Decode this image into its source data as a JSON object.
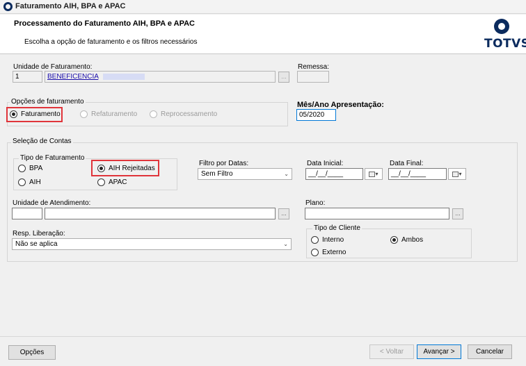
{
  "window": {
    "title": "Faturamento AIH, BPA e APAC"
  },
  "header": {
    "title": "Processamento do Faturamento AIH, BPA e APAC",
    "subtitle": "Escolha a opção de faturamento e os filtros necessários",
    "brand": "TOTVS"
  },
  "unidade_faturamento": {
    "label": "Unidade de Faturamento:",
    "code": "1",
    "name": "BENEFICENCIA"
  },
  "remessa": {
    "label": "Remessa:",
    "value": ""
  },
  "opcoes_faturamento": {
    "legend": "Opções de faturamento",
    "options": [
      {
        "label": "Faturamento",
        "selected": true,
        "enabled": true
      },
      {
        "label": "Refaturamento",
        "selected": false,
        "enabled": false
      },
      {
        "label": "Reprocessamento",
        "selected": false,
        "enabled": false
      }
    ]
  },
  "mes_ano": {
    "label": "Mês/Ano Apresentação:",
    "value": "05/2020"
  },
  "selecao_contas": {
    "legend": "Seleção de Contas",
    "tipo_faturamento": {
      "legend": "Tipo de Faturamento",
      "options": [
        {
          "label": "BPA",
          "selected": false
        },
        {
          "label": "AIH Rejeitadas",
          "selected": true
        },
        {
          "label": "AIH",
          "selected": false
        },
        {
          "label": "APAC",
          "selected": false
        }
      ]
    },
    "filtro_datas": {
      "label": "Filtro por Datas:",
      "value": "Sem Filtro"
    },
    "data_inicial": {
      "label": "Data Inicial:",
      "value": "__/__/____"
    },
    "data_final": {
      "label": "Data Final:",
      "value": "__/__/____"
    },
    "unidade_atendimento": {
      "label": "Unidade de Atendimento:",
      "code": "",
      "name": ""
    },
    "plano": {
      "label": "Plano:",
      "value": ""
    },
    "resp_liberacao": {
      "label": "Resp. Liberação:",
      "value": "Não se aplica"
    },
    "tipo_cliente": {
      "legend": "Tipo de Cliente",
      "options": [
        {
          "label": "Interno",
          "selected": false
        },
        {
          "label": "Ambos",
          "selected": true
        },
        {
          "label": "Externo",
          "selected": false
        }
      ]
    }
  },
  "footer": {
    "opcoes": "Opções",
    "voltar": "< Voltar",
    "avancar": "Avançar >",
    "cancelar": "Cancelar"
  },
  "icons": {
    "ellipsis": "...",
    "dropdown": "▾"
  },
  "colors": {
    "brand": "#0b2b5e",
    "highlight": "#e0343a",
    "link": "#1a0dab",
    "focus": "#0078d7"
  }
}
